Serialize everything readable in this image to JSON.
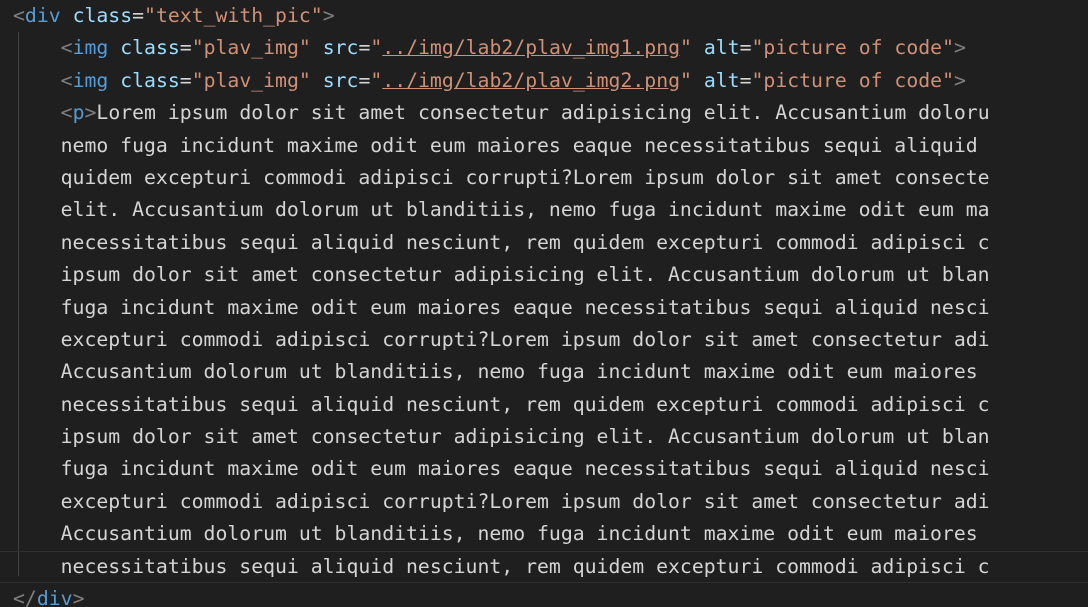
{
  "lines": [
    {
      "kind": "open",
      "indent": "",
      "tag": "div",
      "attr": "class",
      "value": "\"text_with_pic\""
    },
    {
      "kind": "img",
      "indent": "    ",
      "tag": "img",
      "attr1": "class",
      "val1": "\"plav_img\"",
      "attr2": "src",
      "q": "\"",
      "path": "../img/lab2/plav_img1.png",
      "attr3": "alt",
      "val3": "\"picture of code\""
    },
    {
      "kind": "img",
      "indent": "    ",
      "tag": "img",
      "attr1": "class",
      "val1": "\"plav_img\"",
      "attr2": "src",
      "q": "\"",
      "path": "../img/lab2/plav_img2.png",
      "attr3": "alt",
      "val3": "\"picture of code\""
    },
    {
      "kind": "p",
      "indent": "    ",
      "tag": "p",
      "text": "Lorem ipsum dolor sit amet consectetur adipisicing elit. Accusantium doloru"
    },
    {
      "kind": "text",
      "indent": "    ",
      "text": "nemo fuga incidunt maxime odit eum maiores eaque necessitatibus sequi aliquid"
    },
    {
      "kind": "text",
      "indent": "    ",
      "text": "quidem excepturi commodi adipisci corrupti?Lorem ipsum dolor sit amet consecte"
    },
    {
      "kind": "text",
      "indent": "    ",
      "text": "elit. Accusantium dolorum ut blanditiis, nemo fuga incidunt maxime odit eum ma"
    },
    {
      "kind": "text",
      "indent": "    ",
      "text": "necessitatibus sequi aliquid nesciunt, rem quidem excepturi commodi adipisci c"
    },
    {
      "kind": "text",
      "indent": "    ",
      "text": "ipsum dolor sit amet consectetur adipisicing elit. Accusantium dolorum ut blan"
    },
    {
      "kind": "text",
      "indent": "    ",
      "text": "fuga incidunt maxime odit eum maiores eaque necessitatibus sequi aliquid nesci"
    },
    {
      "kind": "text",
      "indent": "    ",
      "text": "excepturi commodi adipisci corrupti?Lorem ipsum dolor sit amet consectetur adi"
    },
    {
      "kind": "text",
      "indent": "    ",
      "text": "Accusantium dolorum ut blanditiis, nemo fuga incidunt maxime odit eum maiores"
    },
    {
      "kind": "text",
      "indent": "    ",
      "text": "necessitatibus sequi aliquid nesciunt, rem quidem excepturi commodi adipisci c"
    },
    {
      "kind": "text",
      "indent": "    ",
      "text": "ipsum dolor sit amet consectetur adipisicing elit. Accusantium dolorum ut blan"
    },
    {
      "kind": "text",
      "indent": "    ",
      "text": "fuga incidunt maxime odit eum maiores eaque necessitatibus sequi aliquid nesci"
    },
    {
      "kind": "text",
      "indent": "    ",
      "text": "excepturi commodi adipisci corrupti?Lorem ipsum dolor sit amet consectetur adi"
    },
    {
      "kind": "text",
      "indent": "    ",
      "text": "Accusantium dolorum ut blanditiis, nemo fuga incidunt maxime odit eum maiores"
    },
    {
      "kind": "text",
      "indent": "    ",
      "text": "necessitatibus sequi aliquid nesciunt, rem quidem excepturi commodi adipisci c",
      "current": true
    },
    {
      "kind": "close",
      "indent": "",
      "tag": "div"
    }
  ],
  "colors": {
    "background": "#1f1f1f",
    "bracket": "#808080",
    "tag": "#569cd6",
    "attribute": "#9cdcfe",
    "string": "#ce9178",
    "text": "#d4d4d4"
  }
}
